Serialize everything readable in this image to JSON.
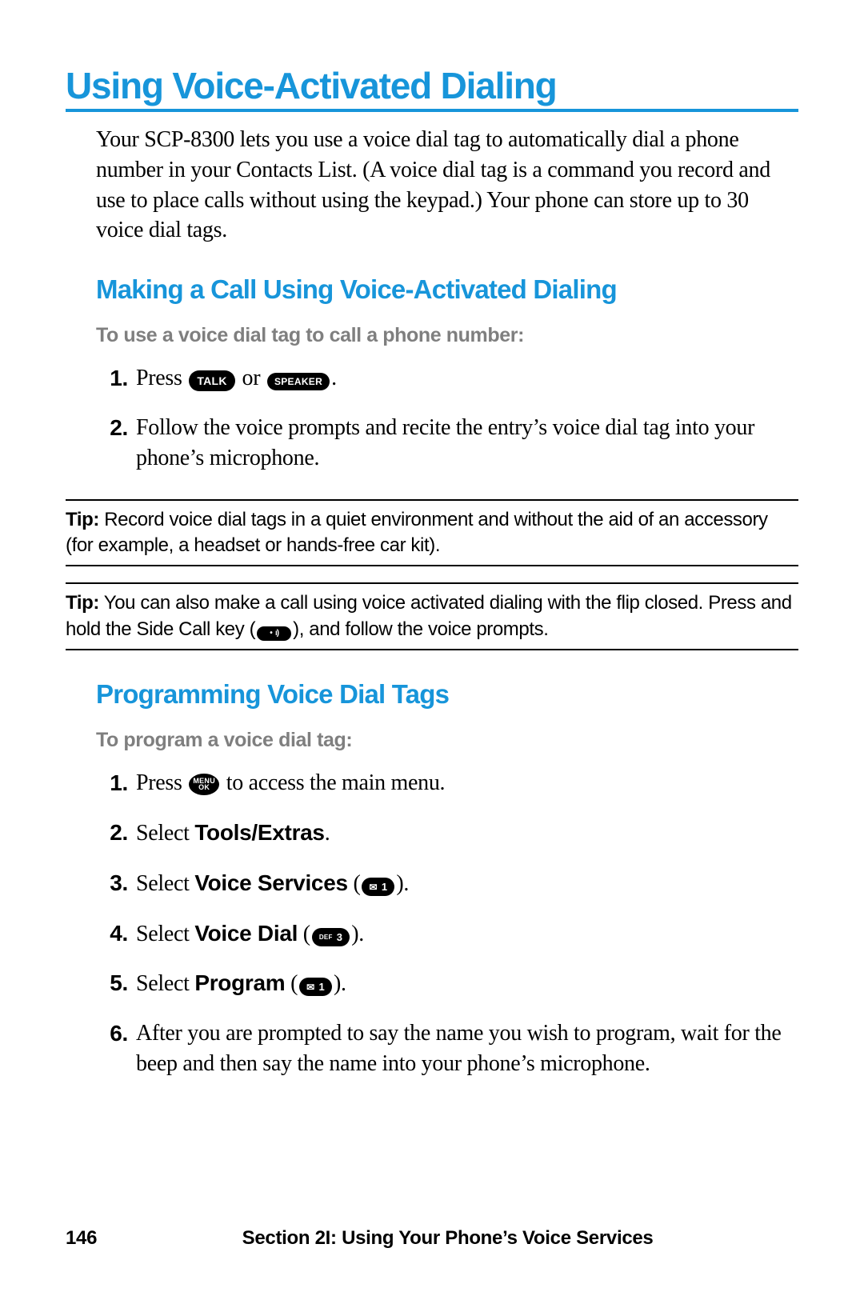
{
  "h1": "Using Voice-Activated Dialing",
  "intro": "Your SCP-8300 lets you use a voice dial tag to automatically dial a phone number in your Contacts List. (A voice dial tag is a command you record and use to place calls without using the keypad.) Your phone can store up to 30 voice dial tags.",
  "h2a": "Making a Call Using Voice-Activated Dialing",
  "h3a": "To use a voice dial tag to call a phone number:",
  "keys": {
    "talk": "TALK",
    "speaker": "SPEAKER",
    "menu1": "MENU",
    "menu2": "OK",
    "def": "DEF",
    "one": "1",
    "three": "3"
  },
  "steps_a": {
    "s1_pre": "Press ",
    "s1_mid": " or ",
    "s1_post": ".",
    "s2": "Follow the voice prompts and recite the entry’s voice dial tag into your phone’s microphone."
  },
  "tip1_label": "Tip:",
  "tip1_text": " Record voice dial tags in a quiet environment and without the aid of an accessory (for example, a headset or hands-free car kit).",
  "tip2_label": "Tip:",
  "tip2_text_a": " You can also make a call using voice activated dialing with the flip closed. Press and hold the Side Call key (",
  "tip2_text_b": "), and follow the voice prompts.",
  "h2b": "Programming Voice Dial Tags",
  "h3b": "To program a voice dial tag:",
  "steps_b": {
    "s1_pre": "Press ",
    "s1_post": " to access the main menu.",
    "s2_pre": "Select ",
    "s2_bold": "Tools/Extras",
    "s2_post": ".",
    "s3_pre": "Select ",
    "s3_bold": "Voice Services",
    "s3_post_a": " (",
    "s3_post_b": ").",
    "s4_pre": "Select ",
    "s4_bold": "Voice Dial",
    "s4_post_a": " (",
    "s4_post_b": ").",
    "s5_pre": "Select ",
    "s5_bold": "Program",
    "s5_post_a": " (",
    "s5_post_b": ").",
    "s6": "After you are prompted to say the name you wish to program, wait for the beep and then say the name into your phone’s microphone."
  },
  "footer": {
    "page": "146",
    "section": "Section 2I: Using Your Phone’s Voice Services"
  }
}
